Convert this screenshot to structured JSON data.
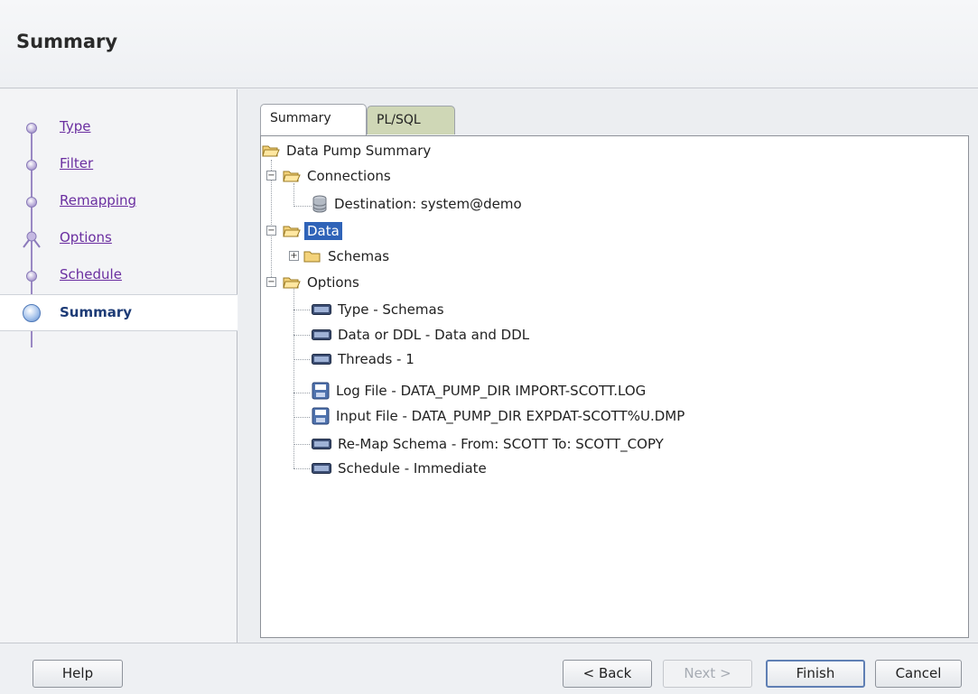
{
  "header": {
    "title": "Summary"
  },
  "steps": [
    {
      "label": "Type"
    },
    {
      "label": "Filter"
    },
    {
      "label": "Remapping"
    },
    {
      "label": "Options"
    },
    {
      "label": "Schedule"
    },
    {
      "label": "Summary"
    }
  ],
  "tabs": [
    {
      "label": "Summary",
      "selected": true
    },
    {
      "label": "PL/SQL",
      "selected": false
    }
  ],
  "tree": {
    "root": "Data Pump Summary",
    "connections": "Connections",
    "destination": "Destination: system@demo",
    "data": "Data",
    "schemas": "Schemas",
    "options": "Options",
    "option_items": [
      "Type - Schemas",
      "Data or DDL - Data and DDL",
      "Threads - 1",
      "Log File - DATA_PUMP_DIR IMPORT-SCOTT.LOG",
      "Input File - DATA_PUMP_DIR EXPDAT-SCOTT%U.DMP",
      "Re-Map Schema - From: SCOTT To: SCOTT_COPY",
      "Schedule - Immediate"
    ],
    "selected": "Data"
  },
  "buttons": {
    "help": "Help",
    "back": "< Back",
    "next": "Next >",
    "finish": "Finish",
    "cancel": "Cancel"
  },
  "colors": {
    "link": "#6a2ea0",
    "selection": "#2f63b8",
    "plsql_tab": "#cfd7b6"
  }
}
